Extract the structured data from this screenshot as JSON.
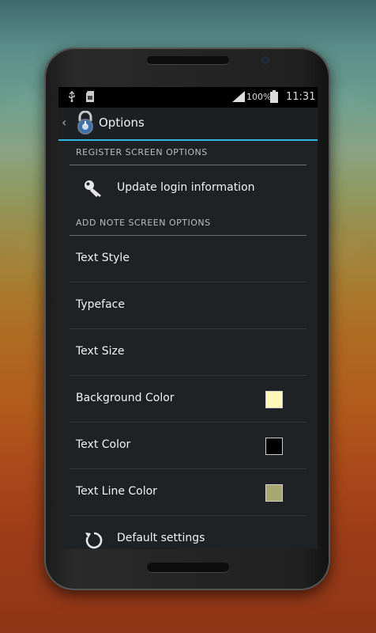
{
  "statusbar": {
    "battery_pct": "100%",
    "time": "11:31"
  },
  "actionbar": {
    "title": "Options"
  },
  "sections": {
    "register": "REGISTER SCREEN OPTIONS",
    "add_note": "ADD NOTE SCREEN OPTIONS"
  },
  "items": {
    "update_login": "Update login information",
    "text_style": "Text Style",
    "typeface": "Typeface",
    "text_size": "Text Size",
    "background_color": "Background Color",
    "text_color": "Text Color",
    "text_line_color": "Text Line Color",
    "default_settings": "Default settings"
  },
  "colors": {
    "background_color": "#fdf8b8",
    "text_color": "#000000",
    "text_line_color": "#a9a870",
    "accent": "#33b5e5"
  },
  "icons": {
    "update_login": "key-icon",
    "default_settings": "reset-icon",
    "app": "lock-icon"
  }
}
